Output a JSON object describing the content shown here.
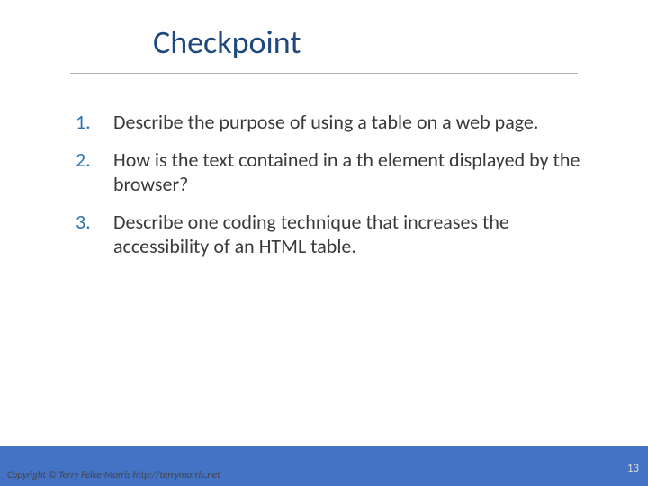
{
  "title": "Checkpoint",
  "items": [
    "Describe the purpose of using a table on a web page.",
    "How is the text contained in a th element displayed by the browser?",
    "Describe one coding technique that increases the accessibility of an HTML table."
  ],
  "copyright": "Copyright © Terry Felke-Morris http://terrymorris.net",
  "page": "13"
}
